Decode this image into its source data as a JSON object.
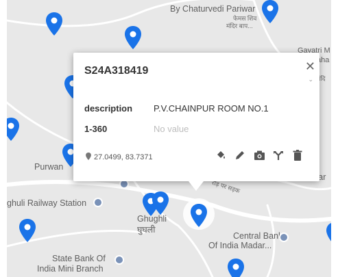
{
  "map": {
    "labels": {
      "chaturvedi_en": "By Chaturvedi Pariwar",
      "chaturvedi_hi_1": "फेमस शिव",
      "chaturvedi_hi_2": "मंदिर बाप...",
      "gayatri_en_1": "Gayatri M",
      "gayatri_en_2": "aha",
      "gayatri_hi": "मंदि",
      "purwan": "Purwan",
      "jar": "Jar",
      "railway_station": "ghuli Railway Station",
      "ghughli_en": "Ghughli",
      "ghughli_hi": "घुघली",
      "road_hi": "रोड़ पर सड़क",
      "central_bank_1": "Central Bank",
      "central_bank_2": "Of India Madar...",
      "sbi_1": "State Bank Of",
      "sbi_2": "India Mini Branch"
    },
    "colors": {
      "pin": "#1a73e8",
      "land": "#e8e8e8",
      "road": "#ffffff",
      "poi": "#7a92b8"
    }
  },
  "popup": {
    "title": "S24A318419",
    "close_icon": "close-icon",
    "fields": [
      {
        "key": "description",
        "value": "P.V.CHAINPUR ROOM NO.1"
      },
      {
        "key": "1-360",
        "value": "No value"
      }
    ],
    "coordinates": "27.0499, 83.7371",
    "actions": [
      "style-icon",
      "edit-icon",
      "camera-icon",
      "route-icon",
      "delete-icon"
    ]
  }
}
